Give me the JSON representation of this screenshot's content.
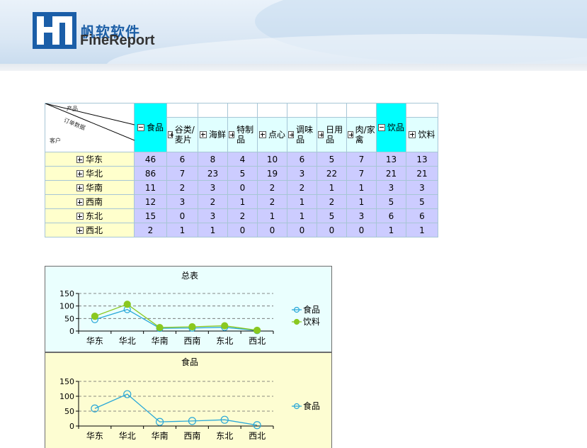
{
  "brand": {
    "name_cn": "帆软软件",
    "name_en": "FineReport",
    "logo_icon": "finereport-logo-icon"
  },
  "colors": {
    "header_cyan": "#00ffff",
    "header_light": "#e0ffff",
    "row_header": "#ffffcc",
    "data_cell": "#ccccff",
    "series_food": "#2aa8d8",
    "series_drinks": "#8ac820"
  },
  "report": {
    "corner": {
      "product": "产品",
      "order_data": "订单数据",
      "customer": "客户"
    },
    "columns": [
      {
        "label": "食品",
        "expander": "minus",
        "highlight": true,
        "group": true
      },
      {
        "label": "谷类/麦片",
        "expander": "plus",
        "highlight": false,
        "group": false
      },
      {
        "label": "海鲜",
        "expander": "plus",
        "highlight": false,
        "group": false
      },
      {
        "label": "特制品",
        "expander": "plus",
        "highlight": false,
        "group": false
      },
      {
        "label": "点心",
        "expander": "plus",
        "highlight": false,
        "group": false
      },
      {
        "label": "调味品",
        "expander": "plus",
        "highlight": false,
        "group": false
      },
      {
        "label": "日用品",
        "expander": "plus",
        "highlight": false,
        "group": false
      },
      {
        "label": "肉/家禽",
        "expander": "plus",
        "highlight": false,
        "group": false
      },
      {
        "label": "饮品",
        "expander": "minus",
        "highlight": true,
        "group": true
      },
      {
        "label": "饮料",
        "expander": "plus",
        "highlight": false,
        "group": false
      }
    ],
    "rows": [
      {
        "region": "华东",
        "values": [
          46,
          6,
          8,
          4,
          10,
          6,
          5,
          7,
          13,
          13
        ]
      },
      {
        "region": "华北",
        "values": [
          86,
          7,
          23,
          5,
          19,
          3,
          22,
          7,
          21,
          21
        ]
      },
      {
        "region": "华南",
        "values": [
          11,
          2,
          3,
          0,
          2,
          2,
          1,
          1,
          3,
          3
        ]
      },
      {
        "region": "西南",
        "values": [
          12,
          3,
          2,
          1,
          2,
          1,
          2,
          1,
          5,
          5
        ]
      },
      {
        "region": "东北",
        "values": [
          15,
          0,
          3,
          2,
          1,
          1,
          5,
          3,
          6,
          6
        ]
      },
      {
        "region": "西北",
        "values": [
          2,
          1,
          1,
          0,
          0,
          0,
          0,
          0,
          1,
          1
        ]
      }
    ]
  },
  "chart_data": [
    {
      "type": "line",
      "title": "总表",
      "categories": [
        "华东",
        "华北",
        "华南",
        "西南",
        "东北",
        "西北"
      ],
      "series": [
        {
          "name": "食品",
          "values": [
            46,
            86,
            11,
            12,
            15,
            2
          ],
          "color": "#2aa8d8",
          "marker": "hollow-circle"
        },
        {
          "name": "饮料",
          "values": [
            59,
            107,
            14,
            17,
            21,
            3
          ],
          "color": "#8ac820",
          "marker": "filled-circle"
        }
      ],
      "yticks": [
        0,
        50,
        100,
        150
      ],
      "ylim": [
        0,
        150
      ],
      "grid": true,
      "legend": "right"
    },
    {
      "type": "line",
      "title": "食品",
      "categories": [
        "华东",
        "华北",
        "华南",
        "西南",
        "东北",
        "西北"
      ],
      "series": [
        {
          "name": "食品",
          "values": [
            59,
            107,
            14,
            17,
            21,
            3
          ],
          "color": "#2aa8d8",
          "marker": "hollow-circle"
        }
      ],
      "yticks": [
        0,
        50,
        100,
        150
      ],
      "ylim": [
        0,
        150
      ],
      "grid": true,
      "legend": "right"
    }
  ]
}
